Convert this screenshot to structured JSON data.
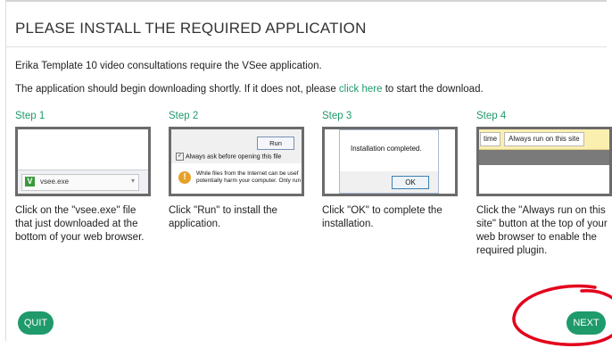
{
  "modal": {
    "title": "PLEASE INSTALL THE REQUIRED APPLICATION",
    "intro_line": "Erika Template 10 video consultations require the VSee application.",
    "download_text_before": "The application should begin downloading shortly. If it does not, please",
    "download_link": "click here",
    "download_text_after": "to start the download."
  },
  "steps": [
    {
      "label": "Step 1",
      "description": "Click on the \"vsee.exe\" file that just downloaded at the bottom of your web browser.",
      "thumb": {
        "file_name": "vsee.exe",
        "file_icon_letter": "V"
      }
    },
    {
      "label": "Step 2",
      "description": "Click \"Run\" to install the application.",
      "thumb": {
        "run_button": "Run",
        "checkbox_label": "Always ask before opening this file",
        "warning_line1": "While files from the Internet can be usef",
        "warning_line2": "potentially harm your computer. Only run"
      }
    },
    {
      "label": "Step 3",
      "description": "Click \"OK\" to complete the installation.",
      "thumb": {
        "message": "Installation completed.",
        "ok_button": "OK"
      }
    },
    {
      "label": "Step 4",
      "description": "Click the \"Always run on this site\" button at the top of your web browser to enable the required plugin.",
      "thumb": {
        "time_label": "time",
        "always_run_button": "Always run on this site"
      }
    }
  ],
  "buttons": {
    "quit": "QUIT",
    "next": "NEXT"
  },
  "colors": {
    "accent": "#1f9a6b",
    "annotation_circle": "#e3001b"
  }
}
